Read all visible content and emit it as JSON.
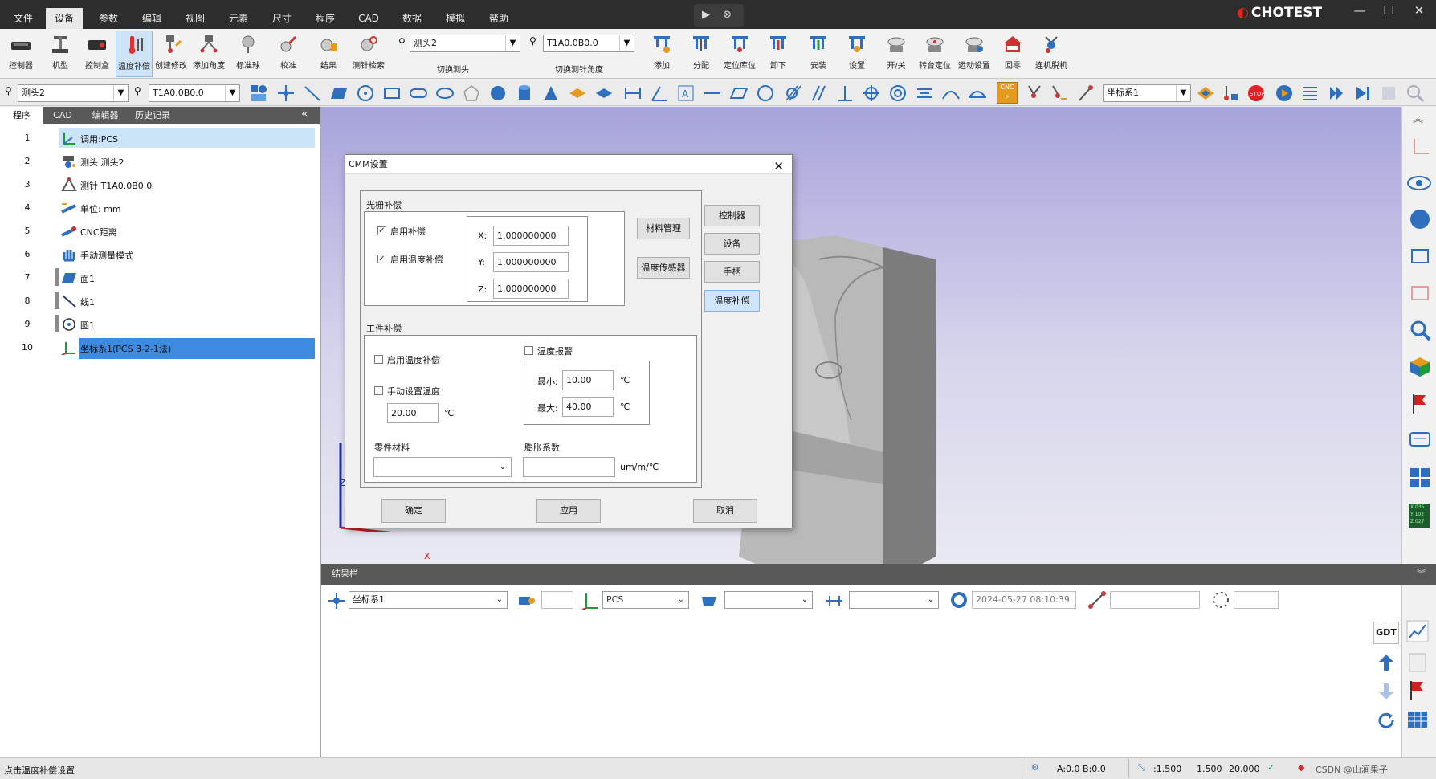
{
  "menubar": {
    "items": [
      "文件",
      "设备",
      "参数",
      "编辑",
      "视图",
      "元素",
      "尺寸",
      "程序",
      "CAD",
      "数据",
      "模拟",
      "帮助"
    ],
    "active": "设备",
    "logo": "CHOTEST",
    "title_icons": [
      "cursor-icon",
      "close-circle-icon"
    ]
  },
  "ribbon": {
    "buttons": [
      "控制器",
      "机型",
      "控制盒",
      "温度补偿",
      "创建修改",
      "添加角度",
      "标准球",
      "校准",
      "结果",
      "测针检索"
    ],
    "probe_combo": "测头2",
    "probe_group_label": "切换测头",
    "tip_combo": "T1A0.0B0.0",
    "tip_group_label": "切换测针角度",
    "buttons_right": [
      "添加",
      "分配",
      "定位库位",
      "卸下",
      "安装",
      "设置",
      "开/关",
      "转台定位",
      "运动设置",
      "回零",
      "连机脱机"
    ]
  },
  "toolbar2": {
    "probe_combo": "测头2",
    "tip_combo": "T1A0.0B0.0",
    "coord_combo": "坐标系1"
  },
  "leftpanel": {
    "tabs": [
      "程序",
      "CAD",
      "编辑器",
      "历史记录"
    ],
    "rows": [
      {
        "num": "1",
        "label": "调用:PCS"
      },
      {
        "num": "2",
        "label": "测头 测头2"
      },
      {
        "num": "3",
        "label": "测针 T1A0.0B0.0"
      },
      {
        "num": "4",
        "label": "单位: mm"
      },
      {
        "num": "5",
        "label": "CNC距离"
      },
      {
        "num": "6",
        "label": "手动测量模式"
      },
      {
        "num": "7",
        "label": "面1"
      },
      {
        "num": "8",
        "label": "线1"
      },
      {
        "num": "9",
        "label": "圆1"
      },
      {
        "num": "10",
        "label": "坐标系1(PCS  3-2-1法)"
      }
    ]
  },
  "dialog": {
    "title": "CMM设置",
    "grating_group": "光栅补偿",
    "enable_comp": "启用补偿",
    "enable_temp_comp": "启用温度补偿",
    "x_label": "X:",
    "x_value": "1.000000000",
    "y_label": "Y:",
    "y_value": "1.000000000",
    "z_label": "Z:",
    "z_value": "1.000000000",
    "material_mgmt": "材料管理",
    "temp_sensor": "温度传感器",
    "workpiece_group": "工件补偿",
    "wp_enable_temp": "启用温度补偿",
    "manual_temp": "手动设置温度",
    "manual_temp_value": "20.00",
    "unit_c": "℃",
    "temp_alarm": "温度报警",
    "min_label": "最小:",
    "min_value": "10.00",
    "max_label": "最大:",
    "max_value": "40.00",
    "part_material": "零件材料",
    "expansion_coef": "膨胀系数",
    "expansion_unit": "um/m/℃",
    "side_buttons": [
      "控制器",
      "设备",
      "手柄",
      "温度补偿"
    ],
    "side_selected": "温度补偿",
    "ok": "确定",
    "apply": "应用",
    "cancel": "取消"
  },
  "result": {
    "header": "结果栏",
    "coord": "坐标系1",
    "pcs": "PCS",
    "timestamp": "2024-05-27 08:10:39",
    "right_buttons": [
      "GDT"
    ]
  },
  "statusbar": {
    "message": "点击温度补偿设置",
    "ab": "A:0.0  B:0.0",
    "step": ":1.500",
    "v2": "1.500",
    "v3": "20.000",
    "watermark": "CSDN @山涧果子"
  },
  "axis": {
    "x_label": "X",
    "z_label": "Z"
  }
}
